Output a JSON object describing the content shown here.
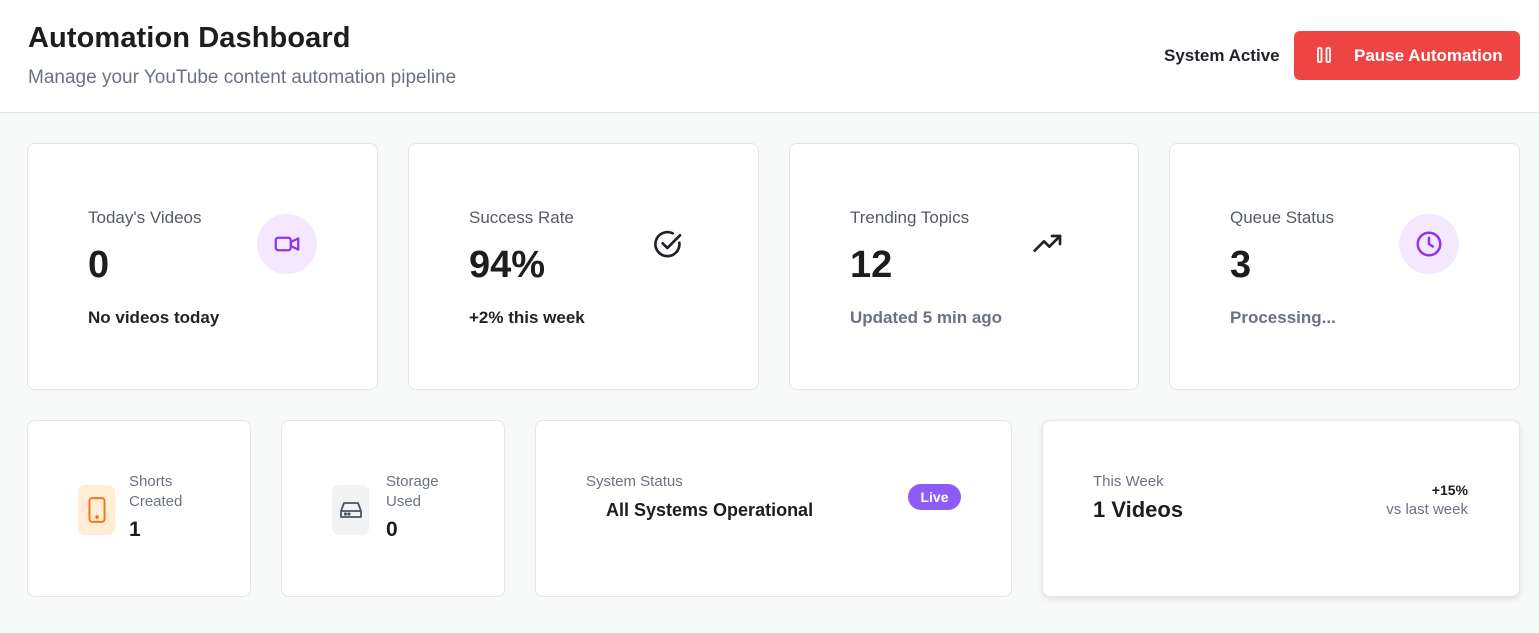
{
  "header": {
    "title": "Automation Dashboard",
    "subtitle": "Manage your YouTube content automation pipeline",
    "system_state": "System Active",
    "pause_button_label": "Pause Automation"
  },
  "stats": [
    {
      "title": "Today's Videos",
      "value": "0",
      "footer": "No videos today",
      "icon": "video-camera-icon"
    },
    {
      "title": "Success Rate",
      "value": "94%",
      "footer": "+2% this week",
      "icon": "check-circle-icon"
    },
    {
      "title": "Trending Topics",
      "value": "12",
      "footer": "Updated 5 min ago",
      "icon": "trending-up-icon"
    },
    {
      "title": "Queue Status",
      "value": "3",
      "footer": "Processing...",
      "icon": "clock-icon"
    }
  ],
  "shorts": {
    "label_line1": "Shorts",
    "label_line2": "Created",
    "value": "1",
    "icon": "mobile-phone-icon"
  },
  "storage": {
    "label_line1": "Storage",
    "label_line2": "Used",
    "value": "0",
    "icon": "hard-drive-icon"
  },
  "system_status": {
    "label": "System Status",
    "value": "All Systems Operational",
    "badge": "Live"
  },
  "this_week": {
    "label": "This Week",
    "value": "1 Videos",
    "change": "+15%",
    "change_caption": "vs last week"
  },
  "colors": {
    "accent_red": "#ef4444",
    "purple": "#8b5cf6",
    "purple_light": "#f3e8ff",
    "orange": "#f97316",
    "orange_light": "#ffedd5"
  }
}
